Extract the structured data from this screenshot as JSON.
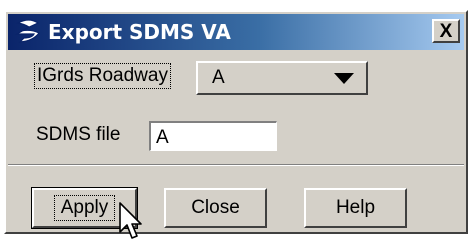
{
  "window": {
    "title": "Export SDMS VA",
    "close_glyph": "X",
    "icon": "bentley-b-icon"
  },
  "form": {
    "roadway_label": "IGrds Roadway",
    "roadway_value": "A",
    "sdms_file_label": "SDMS file",
    "sdms_file_value": "A"
  },
  "buttons": {
    "apply": "Apply",
    "close": "Close",
    "help": "Help"
  },
  "colors": {
    "titlebar_start": "#0a246a",
    "titlebar_end": "#a6caf0",
    "dialog_face": "#d4d0c8"
  }
}
